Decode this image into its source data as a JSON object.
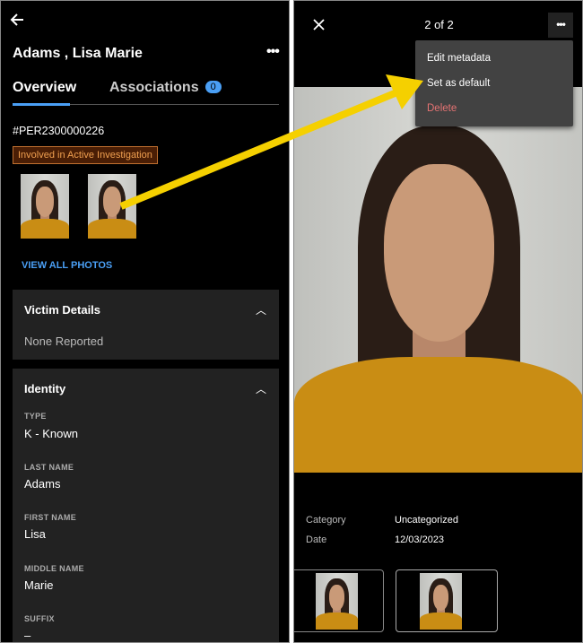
{
  "left": {
    "back_icon": "arrow-left",
    "title": "Adams , Lisa Marie",
    "more_icon": "more-horizontal",
    "tabs": [
      {
        "label": "Overview",
        "active": true
      },
      {
        "label": "Associations",
        "badge": "0"
      }
    ],
    "record_id": "#PER2300000226",
    "status_tag": "Involved in Active Investigation",
    "view_all_photos": "VIEW ALL PHOTOS",
    "victim_details": {
      "title": "Victim Details",
      "value": "None Reported"
    },
    "identity": {
      "title": "Identity",
      "fields": [
        {
          "label": "TYPE",
          "value": "K - Known"
        },
        {
          "label": "LAST NAME",
          "value": "Adams"
        },
        {
          "label": "FIRST NAME",
          "value": "Lisa"
        },
        {
          "label": "MIDDLE NAME",
          "value": "Marie"
        },
        {
          "label": "SUFFIX",
          "value": "–"
        }
      ]
    }
  },
  "right": {
    "close_icon": "close",
    "counter": "2 of 2",
    "menu": {
      "items": [
        "Edit metadata",
        "Set as default",
        "Delete"
      ]
    },
    "meta": [
      {
        "label": "Category",
        "value": "Uncategorized"
      },
      {
        "label": "Date",
        "value": "12/03/2023"
      }
    ]
  },
  "colors": {
    "accent": "#4a9ff5",
    "tag_bg": "#4a1e05",
    "tag_text": "#f0a050",
    "delete": "#e57373",
    "arrow": "#f5d000",
    "card": "#222222"
  }
}
